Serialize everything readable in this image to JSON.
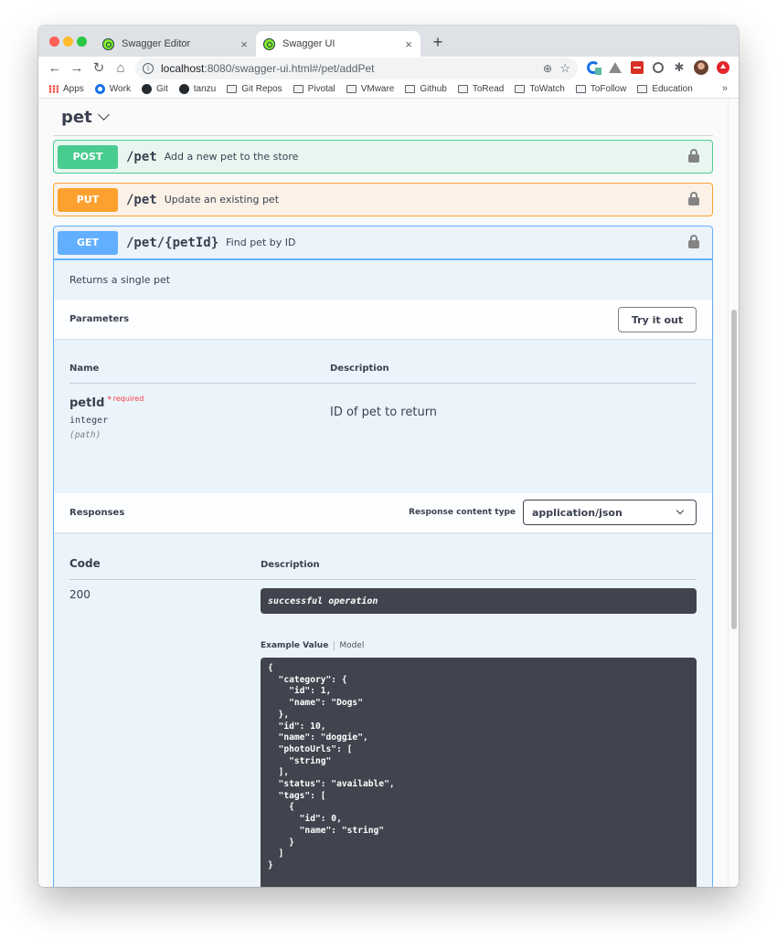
{
  "browser": {
    "tabs": [
      {
        "title": "Swagger Editor",
        "active": false
      },
      {
        "title": "Swagger UI",
        "active": true
      }
    ],
    "new_tab_label": "+",
    "close_glyph": "×",
    "nav": {
      "back": "←",
      "forward": "→",
      "reload": "↻",
      "home": "⌂"
    },
    "url": {
      "host": "localhost",
      "rest": ":8080/swagger-ui.html#/pet/addPet"
    },
    "zoom_glyph": "⊕",
    "star_glyph": "☆",
    "extensions": [
      "sync-extension-icon",
      "drive-icon",
      "lastpass-icon",
      "circle-extension-icon",
      "puzzle-icon",
      "profile-avatar",
      "update-icon"
    ],
    "bookmarks": [
      {
        "label": "Apps",
        "icon": "apps-grid-icon"
      },
      {
        "label": "Work",
        "icon": "circle-icon"
      },
      {
        "label": "Git",
        "icon": "github-icon"
      },
      {
        "label": "tanzu",
        "icon": "github-icon"
      },
      {
        "label": "Git Repos",
        "icon": "folder-icon"
      },
      {
        "label": "Pivotal",
        "icon": "folder-icon"
      },
      {
        "label": "VMware",
        "icon": "folder-icon"
      },
      {
        "label": "Github",
        "icon": "folder-icon"
      },
      {
        "label": "ToRead",
        "icon": "folder-icon"
      },
      {
        "label": "ToWatch",
        "icon": "folder-icon"
      },
      {
        "label": "ToFollow",
        "icon": "folder-icon"
      },
      {
        "label": "Education",
        "icon": "folder-icon"
      }
    ],
    "bookmarks_more": "»"
  },
  "swagger": {
    "tag": "pet",
    "operations": [
      {
        "method": "POST",
        "path": "/pet",
        "summary": "Add a new pet to the store",
        "color": "#49cc90"
      },
      {
        "method": "PUT",
        "path": "/pet",
        "summary": "Update an existing pet",
        "color": "#fca130"
      },
      {
        "method": "GET",
        "path": "/pet/{petId}",
        "summary": "Find pet by ID",
        "color": "#61affe",
        "expanded": true
      }
    ],
    "expanded": {
      "description": "Returns a single pet",
      "parameters_title": "Parameters",
      "try_it_out_label": "Try it out",
      "param_columns": [
        "Name",
        "Description"
      ],
      "params": [
        {
          "name": "petId",
          "required_star": "*",
          "required_label": "required",
          "type": "integer",
          "in": "(path)",
          "description": "ID of pet to return"
        }
      ],
      "responses_title": "Responses",
      "response_content_type_label": "Response content type",
      "response_content_type_value": "application/json",
      "response_columns": [
        "Code",
        "Description"
      ],
      "responses": [
        {
          "code": "200",
          "description": "successful operation",
          "example_tabs": [
            "Example Value",
            "Model"
          ],
          "example_value": "{\n  \"category\": {\n    \"id\": 1,\n    \"name\": \"Dogs\"\n  },\n  \"id\": 10,\n  \"name\": \"doggie\",\n  \"photoUrls\": [\n    \"string\"\n  ],\n  \"status\": \"available\",\n  \"tags\": [\n    {\n      \"id\": 0,\n      \"name\": \"string\"\n    }\n  ]\n}"
        }
      ]
    }
  }
}
